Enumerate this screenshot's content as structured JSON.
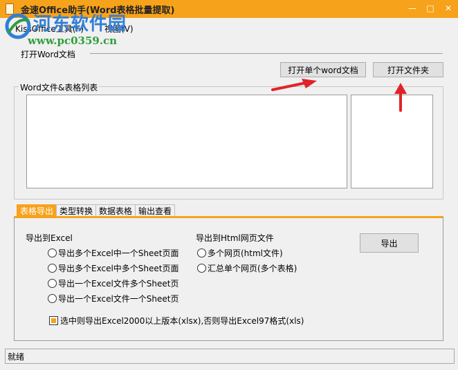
{
  "window": {
    "title": "金速Office助手(Word表格批量提取)"
  },
  "menu": [
    "KissOffice工具(F)",
    "视图(V)"
  ],
  "watermark": {
    "title": "河东软件园",
    "url": "www.pc0359.cn"
  },
  "open_section": {
    "label": "打开Word文档",
    "open_word_button": "打开单个word文档",
    "open_folder_button": "打开文件夹"
  },
  "list_group": {
    "label": "Word文件&表格列表"
  },
  "tabs": [
    "表格导出",
    "类型转换",
    "数据表格",
    "输出查看"
  ],
  "export_panel": {
    "excel_label": "导出到Excel",
    "excel_options": [
      "导出多个Excel中一个Sheet页面",
      "导出多个Excel中多个Sheet页面",
      "导出一个Excel文件多个Sheet页",
      "导出一个Excel文件一个Sheet页"
    ],
    "html_label": "导出到Html网页文件",
    "html_options": [
      "多个网页(html文件)",
      "汇总单个网页(多个表格)"
    ],
    "export_button": "导出",
    "checkbox_label": "选中则导出Excel2000以上版本(xlsx),否则导出Excel97格式(xls)"
  },
  "status": "就绪",
  "colors": {
    "accent": "#f7a21b",
    "annotation_arrow": "#e0232a"
  }
}
